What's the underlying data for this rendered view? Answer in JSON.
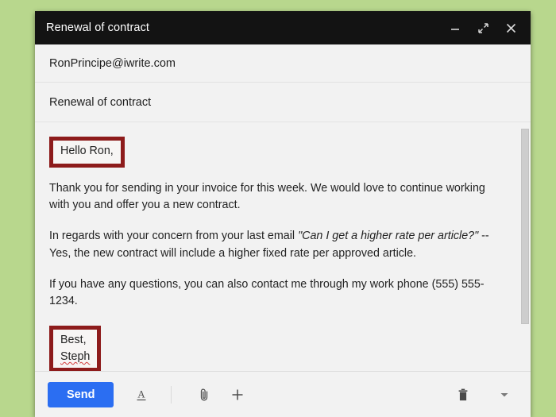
{
  "page": {
    "background_color": "#b8d78d"
  },
  "window": {
    "title": "Renewal of contract",
    "title_bar_color": "#131313",
    "controls": [
      {
        "name": "minimize",
        "label": "—"
      },
      {
        "name": "expand",
        "label": "⤡"
      },
      {
        "name": "close",
        "label": "✕"
      }
    ]
  },
  "compose": {
    "recipient": "RonPrincipe@iwrite.com",
    "recipient_placeholder": "Recipients",
    "subject": "Renewal of contract",
    "subject_placeholder": "Subject",
    "body": {
      "greeting": "Hello Ron,",
      "paragraph1": "Thank you for sending in your invoice for this week. We would love to continue working with you and offer you a new contract.",
      "paragraph2_before": "In regards with your concern from your last email ",
      "paragraph2_quote": "\"Can I get a higher rate per article?\"",
      "paragraph2_after": " -- Yes, the new contract will include a higher fixed rate per approved article.",
      "paragraph3": "If you have any questions, you can also contact me through my work phone (555) 555-1234.",
      "signoff": "Best,",
      "signature_name": "Steph"
    }
  },
  "annotations": {
    "highlight_color": "#8d1b1b",
    "greeting_box": "Hello Ron,",
    "signature_box": "Best, Steph"
  },
  "toolbar": {
    "send_label": "Send",
    "send_color": "#2b6ef2",
    "format_icon": "format-text-icon",
    "attach_icon": "paperclip-icon",
    "insert_icon": "plus-icon",
    "delete_icon": "trash-icon",
    "more_icon": "chevron-down-icon"
  },
  "scrollbar": {
    "thumb_color": "#cdcdcd"
  }
}
